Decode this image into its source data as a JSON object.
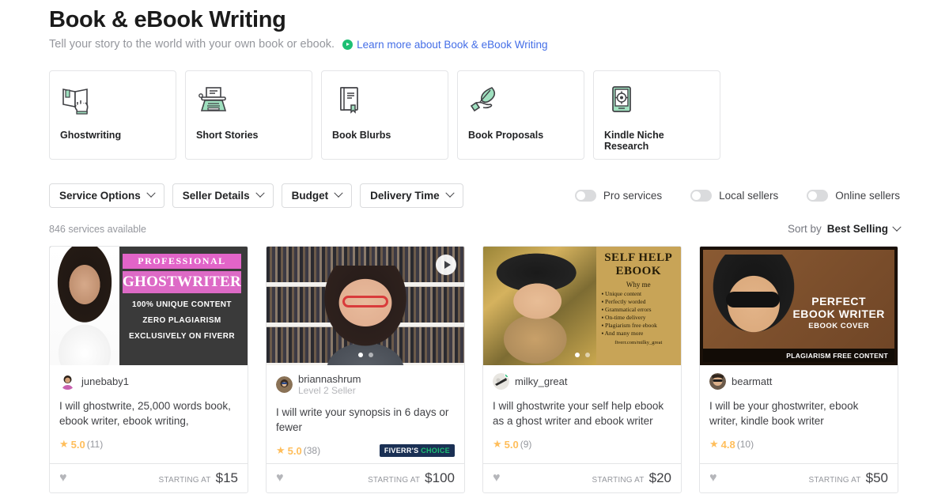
{
  "header": {
    "title": "Book & eBook Writing",
    "subtitle": "Tell your story to the world with your own book or ebook.",
    "learn_more": "Learn more about Book & eBook Writing",
    "learn_more_icon": "play-circle-icon",
    "link_color": "#446ee7",
    "accent_green": "#1dbf73"
  },
  "categories": [
    {
      "label": "Ghostwriting",
      "icon": "open-book-hand-icon"
    },
    {
      "label": "Short Stories",
      "icon": "typewriter-icon"
    },
    {
      "label": "Book Blurbs",
      "icon": "closed-book-icon"
    },
    {
      "label": "Book Proposals",
      "icon": "hand-feather-icon"
    },
    {
      "label": "Kindle Niche Research",
      "icon": "tablet-target-icon"
    }
  ],
  "filters": [
    {
      "label": "Service Options",
      "icon": "chevron-down-icon"
    },
    {
      "label": "Seller Details",
      "icon": "chevron-down-icon"
    },
    {
      "label": "Budget",
      "icon": "chevron-down-icon"
    },
    {
      "label": "Delivery Time",
      "icon": "chevron-down-icon"
    }
  ],
  "toggles": [
    {
      "label": "Pro services",
      "on": false
    },
    {
      "label": "Local sellers",
      "on": false
    },
    {
      "label": "Online sellers",
      "on": false
    }
  ],
  "results": {
    "count_text": "846 services available",
    "sort_prefix": "Sort by",
    "sort_value": "Best Selling",
    "sort_icon": "chevron-down-icon"
  },
  "labels": {
    "starting_at": "STARTING AT",
    "heart_icon": "heart-icon",
    "star_icon": "star-icon",
    "star_color": "#ffbe5b"
  },
  "gigs": [
    {
      "seller": "junebaby1",
      "level": "",
      "online": false,
      "title": "I will ghostwrite, 25,000 words book, ebook writer, ebook writing,",
      "rating": "5.0",
      "reviews": "(11)",
      "price": "$15",
      "badge": null,
      "has_video": false,
      "dots": 0,
      "thumb": {
        "style": "ghostwriter-promo",
        "line1": "PROFESSIONAL",
        "line2": "GHOSTWRITER",
        "bullets": [
          "100% UNIQUE CONTENT",
          "ZERO PLAGIARISM",
          "EXCLUSIVELY ON FIVERR"
        ]
      }
    },
    {
      "seller": "briannashrum",
      "level": "Level 2 Seller",
      "online": false,
      "title": "I will write your synopsis in 6 days or fewer",
      "rating": "5.0",
      "reviews": "(38)",
      "price": "$100",
      "badge": {
        "part1": "FIVERR'S",
        "part2": "CHOICE"
      },
      "has_video": true,
      "dots": 2,
      "thumb": {
        "style": "video-bookshelf"
      }
    },
    {
      "seller": "milky_great",
      "level": "",
      "online": true,
      "title": "I will ghostwrite your self help ebook as a ghost writer and ebook writer",
      "rating": "5.0",
      "reviews": "(9)",
      "price": "$20",
      "badge": null,
      "has_video": false,
      "dots": 2,
      "thumb": {
        "style": "self-help-ebook",
        "line1": "SELF HELP",
        "line2": "EBOOK",
        "why": "Why me",
        "bullets": [
          "Unique content",
          "Perfectly worded",
          "Grammatical errors",
          "On-time delivery",
          "Plagiarism free ebook",
          "And many more"
        ],
        "url": "fiverr.com/milky_great"
      }
    },
    {
      "seller": "bearmatt",
      "level": "",
      "online": false,
      "title": "I will be your ghostwriter, ebook writer, kindle book writer",
      "rating": "4.8",
      "reviews": "(10)",
      "price": "$50",
      "badge": null,
      "has_video": false,
      "dots": 0,
      "thumb": {
        "style": "perfect-ebook-writer",
        "line1": "PERFECT",
        "line2": "EBOOK WRITER",
        "line3": "EBOOK COVER",
        "footer": "PLAGIARISM FREE CONTENT"
      }
    }
  ]
}
